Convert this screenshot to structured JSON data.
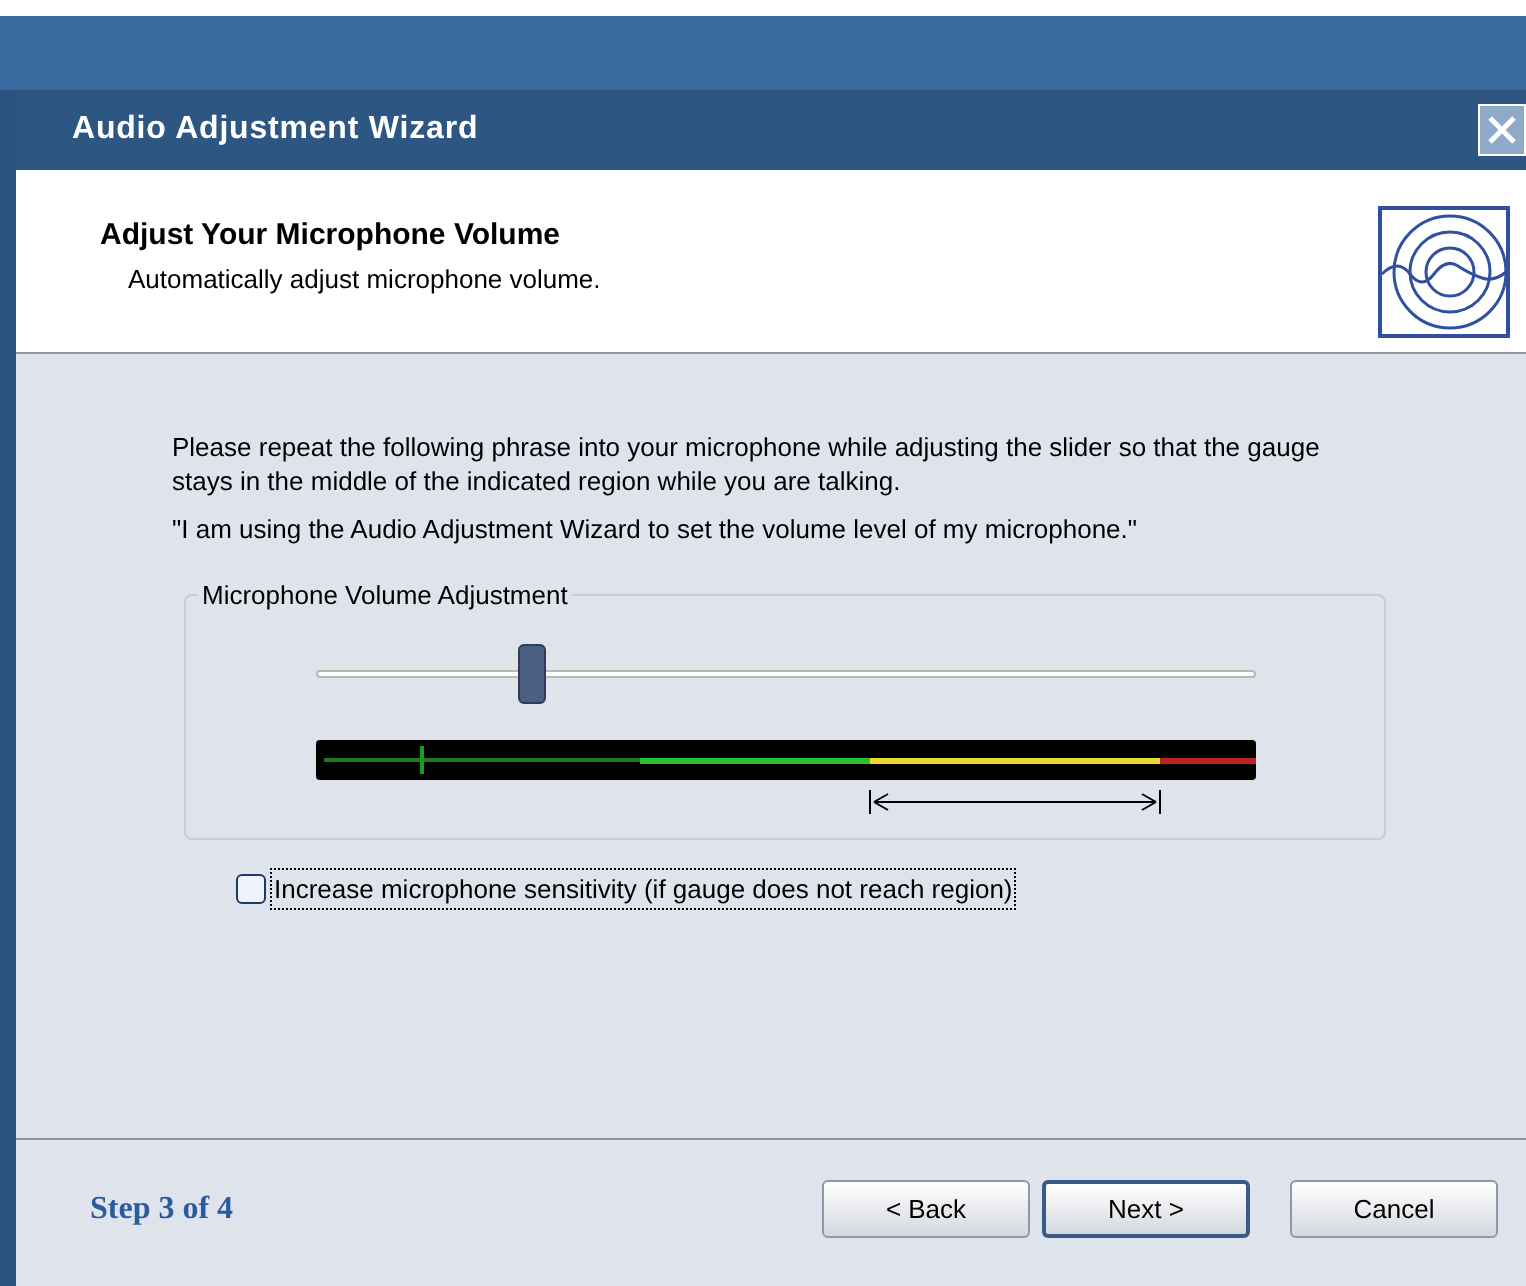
{
  "window": {
    "title": "Audio Adjustment Wizard"
  },
  "header": {
    "title": "Adjust Your Microphone Volume",
    "subtitle": "Automatically adjust microphone volume."
  },
  "instructions": "Please repeat the following phrase into your microphone while adjusting the slider so that the gauge stays in the middle of the indicated region while you are talking.",
  "phrase": "\"I am using the Audio Adjustment Wizard to set the volume level of my microphone.\"",
  "volume_group": {
    "label": "Microphone Volume Adjustment",
    "slider": {
      "level": 0.23
    },
    "gauge": {
      "level": 0.11
    }
  },
  "sensitivity_checkbox": {
    "label": "Increase microphone sensitivity (if gauge does not reach region)",
    "checked": false
  },
  "footer": {
    "step": "Step 3 of 4",
    "buttons": [
      {
        "label": "< Back",
        "default": false
      },
      {
        "label": "Next >",
        "default": true
      },
      {
        "label": "Cancel",
        "default": false
      }
    ]
  }
}
